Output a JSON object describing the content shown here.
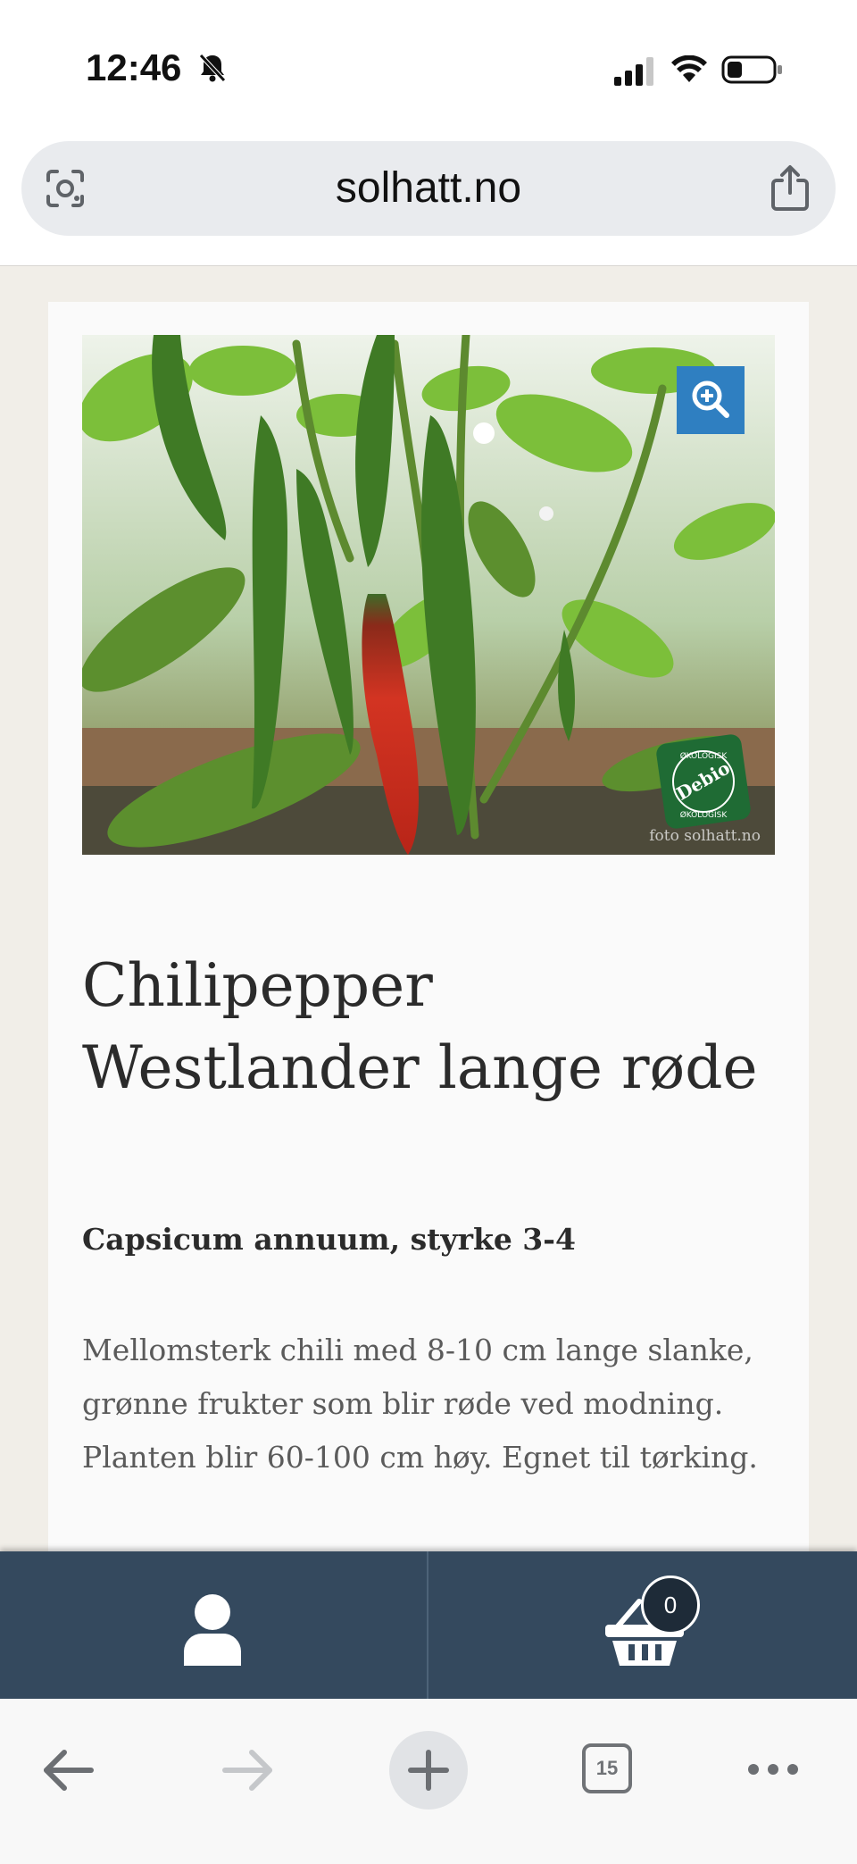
{
  "status_bar": {
    "time": "12:46"
  },
  "browser": {
    "url": "solhatt.no",
    "tab_count": "15"
  },
  "product": {
    "title": "Chilipepper Westlander lange røde",
    "subtitle": "Capsicum annuum, styrke 3-4",
    "description": "Mellomsterk chili med 8-10 cm lange slanke, grønne frukter som blir røde ved modning. Planten blir 60-100 cm høy. Egnet til tørking.",
    "image": {
      "badge_text_top": "ØKOLOGISK",
      "badge_brand": "Debio",
      "badge_text_bottom": "ØKOLOGISK",
      "watermark": "foto solhatt.no"
    }
  },
  "site_toolbar": {
    "cart_count": "0"
  },
  "colors": {
    "site_toolbar_bg": "#34495e",
    "zoom_button": "#2f7fc1",
    "page_bg": "#f1eee8"
  },
  "icons": [
    "bell-off-icon",
    "signal-icon",
    "wifi-icon",
    "battery-icon",
    "lens-icon",
    "share-icon",
    "zoom-in-icon",
    "user-icon",
    "basket-icon",
    "back-arrow-icon",
    "forward-arrow-icon",
    "plus-icon",
    "tabs-icon",
    "more-icon"
  ]
}
